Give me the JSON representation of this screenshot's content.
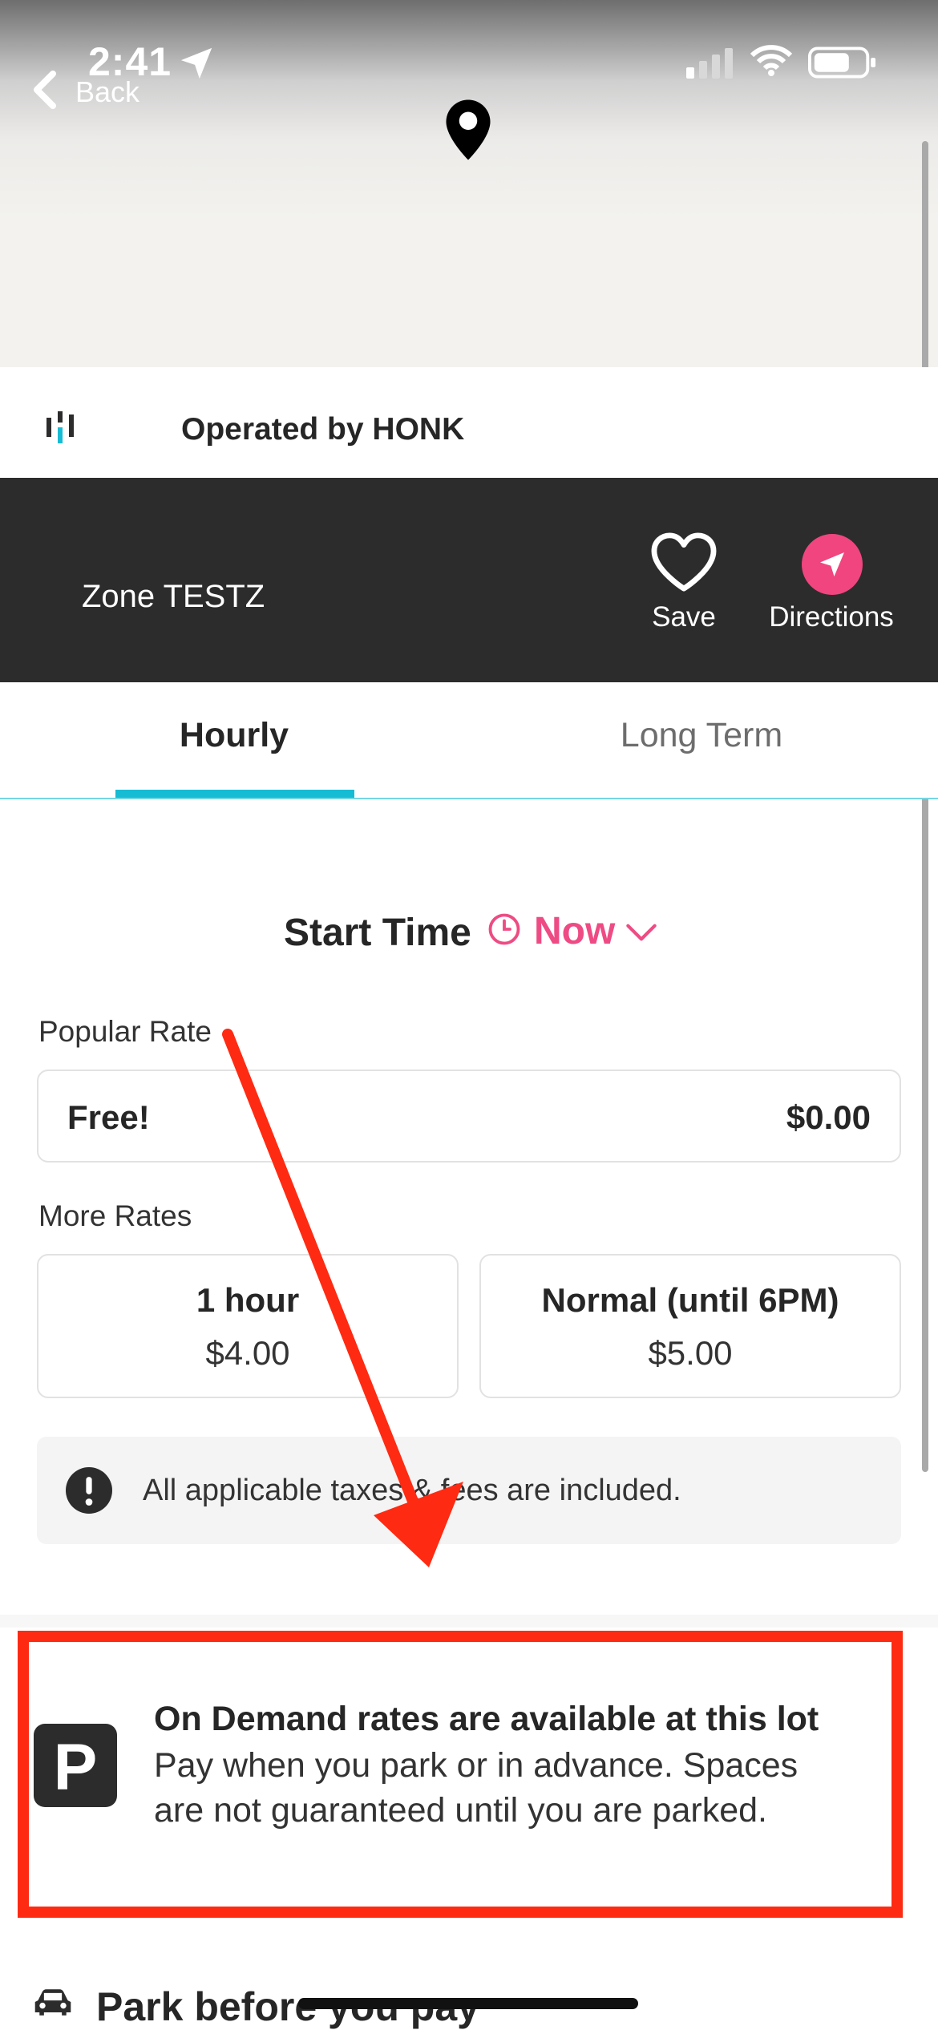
{
  "status_bar": {
    "time": "2:41",
    "back_label": "Back"
  },
  "operator": {
    "text": "Operated by HONK"
  },
  "zone": {
    "name": "Zone TESTZ",
    "save_label": "Save",
    "directions_label": "Directions"
  },
  "tabs": {
    "hourly": "Hourly",
    "long_term": "Long Term",
    "active": "Hourly"
  },
  "start_time": {
    "label": "Start Time",
    "value": "Now"
  },
  "popular": {
    "label": "Popular Rate",
    "rate": {
      "name": "Free!",
      "price": "$0.00"
    }
  },
  "more_rates": {
    "label": "More Rates",
    "items": [
      {
        "name": "1 hour",
        "price": "$4.00"
      },
      {
        "name": "Normal (until 6PM)",
        "price": "$5.00"
      }
    ]
  },
  "tax_note": "All applicable taxes & fees are included.",
  "on_demand": {
    "title": "On Demand rates are available at this lot",
    "line1": "Pay when you park or in advance. Spaces",
    "line2": "are not guaranteed until you are parked."
  },
  "bottom_section": {
    "title": "Park before you pay"
  },
  "colors": {
    "accent_pink": "#ee4b84",
    "accent_teal": "#16bcd3",
    "dark_bar": "#2c2c2c",
    "annotation_red": "#ff2a12"
  },
  "icons": [
    "back-chevron-icon",
    "location-arrow-icon",
    "signal-icon",
    "wifi-icon",
    "battery-icon",
    "map-pin-icon",
    "honk-logo-icon",
    "heart-icon",
    "navigation-icon",
    "clock-icon",
    "chevron-down-icon",
    "exclamation-icon",
    "parking-icon",
    "car-icon"
  ]
}
